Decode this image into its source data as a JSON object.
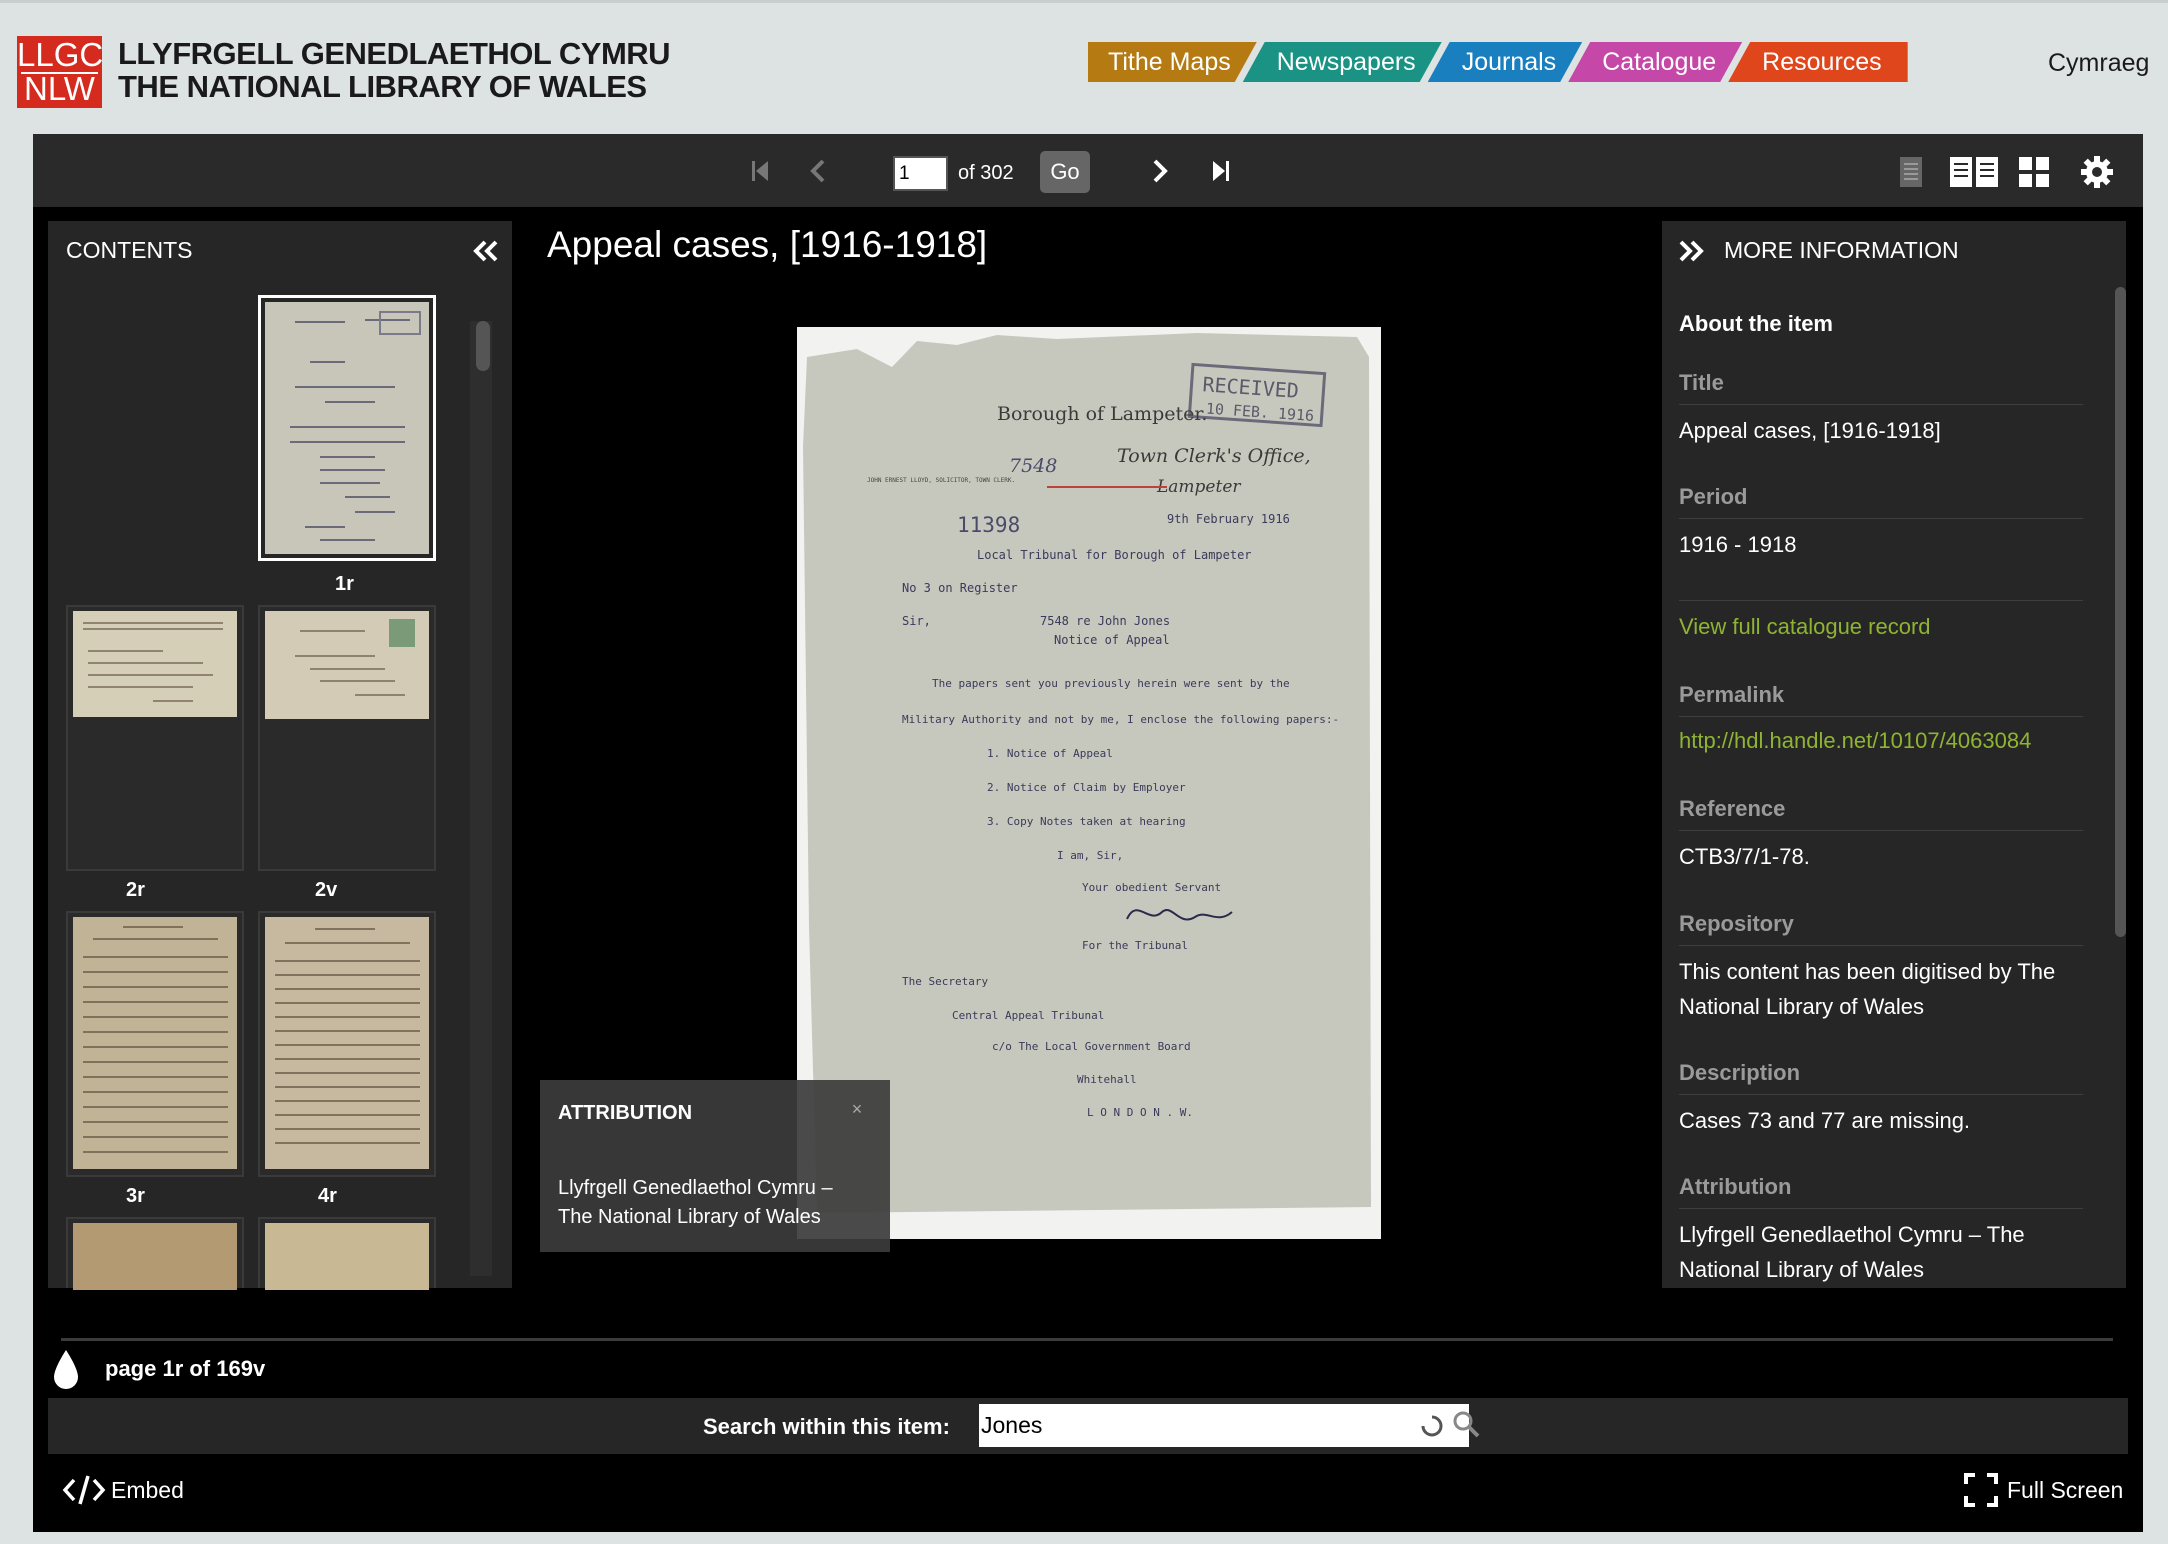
{
  "header": {
    "logo_line1": "LLGC",
    "logo_line2": "NLW",
    "site_name_line1": "LLYFRGELL GENEDLAETHOL CYMRU",
    "site_name_line2": "THE NATIONAL LIBRARY OF WALES",
    "nav": [
      {
        "label": "Tithe Maps",
        "color": "#b57b12"
      },
      {
        "label": "Newspapers",
        "color": "#1a9384"
      },
      {
        "label": "Journals",
        "color": "#1a7fbf"
      },
      {
        "label": "Catalogue",
        "color": "#c548a8"
      },
      {
        "label": "Resources",
        "color": "#e0461c"
      }
    ],
    "language_link": "Cymraeg"
  },
  "toolbar": {
    "page_value": "1",
    "page_of": "of 302",
    "go_label": "Go"
  },
  "contents": {
    "title": "CONTENTS",
    "thumbnails": [
      {
        "label": "1r"
      },
      {
        "label": "2r"
      },
      {
        "label": "2v"
      },
      {
        "label": "3r"
      },
      {
        "label": "4r"
      }
    ]
  },
  "document": {
    "title": "Appeal cases, [1916-1918]",
    "image_text": {
      "received": "RECEIVED",
      "received_date": "10 FEB. 1916",
      "borough": "Borough of Lampeter.",
      "number_7548": "7548",
      "town_clerks": "Town Clerk's Office,",
      "lampeter": "Lampeter",
      "letterhead": "JOHN ERNEST LLOYD, SOLICITOR, TOWN CLERK.",
      "ref_11398": "11398",
      "date": "9th February 1916",
      "line_tribunal": "Local Tribunal for Borough of Lampeter",
      "line_register": "No 3 on Register",
      "line_sir": "Sir,",
      "line_re": "7548 re John Jones",
      "line_notice": "Notice of Appeal",
      "line_p1": "The papers sent you previously herein were sent by the",
      "line_p2": "Military Authority and not by me, I enclose the following papers:-",
      "line_i1": "1. Notice of Appeal",
      "line_i2": "2. Notice of Claim by Employer",
      "line_i3": "3. Copy Notes taken at hearing",
      "line_iam": "I am, Sir,",
      "line_servant": "Your obedient Servant",
      "line_for": "For the Tribunal",
      "line_sec": "The Secretary",
      "line_cat": "Central Appeal Tribunal",
      "line_lgb": "c/o The Local Government Board",
      "line_wh": "Whitehall",
      "line_london": "L O N D O N . W."
    }
  },
  "attribution": {
    "title": "ATTRIBUTION",
    "close": "×",
    "text": "Llyfrgell Genedlaethol Cymru – The National Library of Wales"
  },
  "info": {
    "title": "MORE INFORMATION",
    "about_heading": "About the item",
    "title_label": "Title",
    "title_value": "Appeal cases, [1916-1918]",
    "period_label": "Period",
    "period_value": "1916 - 1918",
    "catalogue_link": "View full catalogue record",
    "permalink_label": "Permalink",
    "permalink_value": "http://hdl.handle.net/10107/4063084",
    "reference_label": "Reference",
    "reference_value": "CTB3/7/1-78.",
    "repository_label": "Repository",
    "repository_value": "This content has been digitised by The National Library of Wales",
    "description_label": "Description",
    "description_value": "Cases 73 and 77 are missing.",
    "attribution_label": "Attribution",
    "attribution_value": "Llyfrgell Genedlaethol Cymru – The National Library of Wales"
  },
  "footer": {
    "page_indicator": "page 1r of 169v",
    "search_label": "Search within this item:",
    "search_value": "Jones",
    "embed_label": "Embed",
    "fullscreen_label": "Full Screen"
  }
}
